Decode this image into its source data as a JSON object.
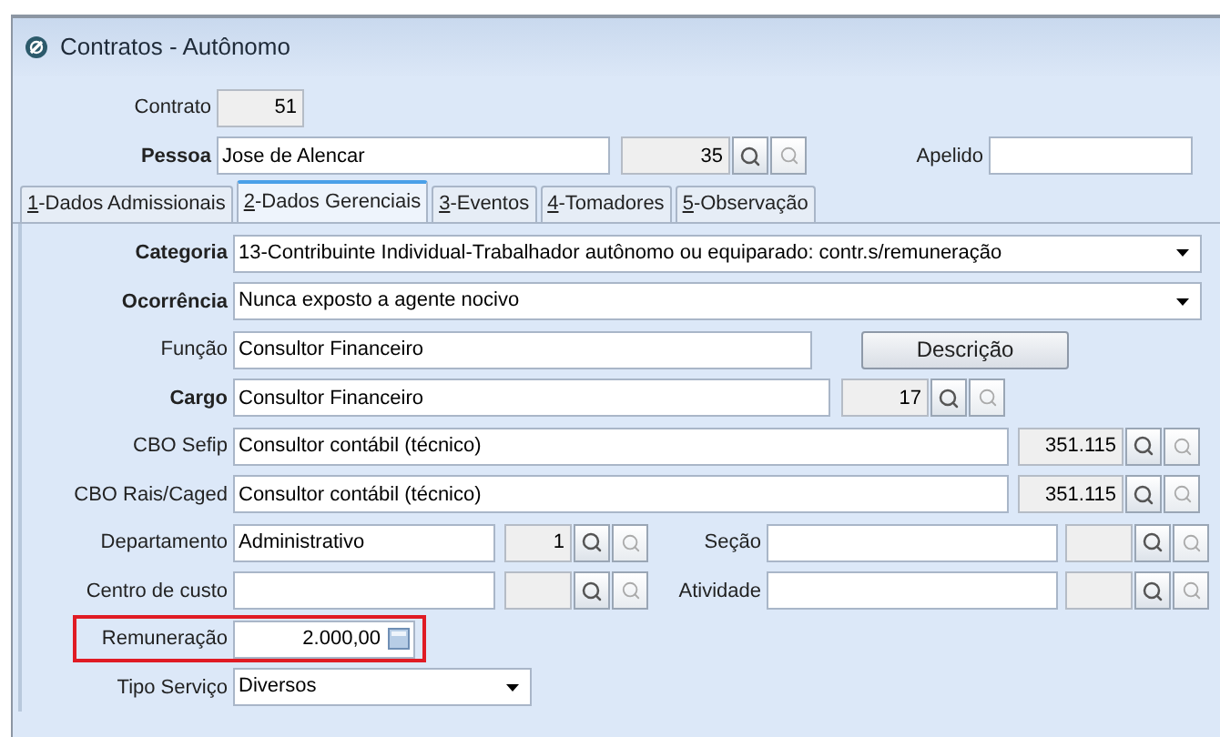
{
  "window": {
    "title": "Contratos - Autônomo"
  },
  "header": {
    "contrato": {
      "label": "Contrato",
      "value": "51"
    },
    "pessoa": {
      "label": "Pessoa",
      "value": "Jose de Alencar",
      "code": "35"
    },
    "apelido": {
      "label": "Apelido"
    }
  },
  "tabs": [
    {
      "label": "1-Dados Admissionais",
      "selected": false
    },
    {
      "label": "2-Dados Gerenciais",
      "selected": true
    },
    {
      "label": "3-Eventos",
      "selected": false
    },
    {
      "label": "4-Tomadores",
      "selected": false
    },
    {
      "label": "5-Observação",
      "selected": false
    }
  ],
  "form": {
    "categoria": {
      "label": "Categoria",
      "value": "13-Contribuinte Individual-Trabalhador autônomo ou equiparado: contr.s/remuneração"
    },
    "ocorrencia": {
      "label": "Ocorrência",
      "value": "Nunca exposto a agente nocivo"
    },
    "funcao": {
      "label": "Função",
      "value": "Consultor Financeiro",
      "button": "Descrição"
    },
    "cargo": {
      "label": "Cargo",
      "value": "Consultor Financeiro",
      "code": "17"
    },
    "cbo_sefip": {
      "label": "CBO Sefip",
      "value": "Consultor contábil (técnico)",
      "code": "351.115"
    },
    "cbo_rais": {
      "label": "CBO Rais/Caged",
      "value": "Consultor contábil (técnico)",
      "code": "351.115"
    },
    "departamento": {
      "label": "Departamento",
      "value": "Administrativo",
      "code": "1"
    },
    "secao": {
      "label": "Seção"
    },
    "centro_custo": {
      "label": "Centro de custo"
    },
    "atividade": {
      "label": "Atividade"
    },
    "remuneracao": {
      "label": "Remuneração",
      "value": "2.000,00",
      "highlighted": true
    },
    "tipo_servico": {
      "label": "Tipo Serviço",
      "value": "Diversos"
    }
  }
}
